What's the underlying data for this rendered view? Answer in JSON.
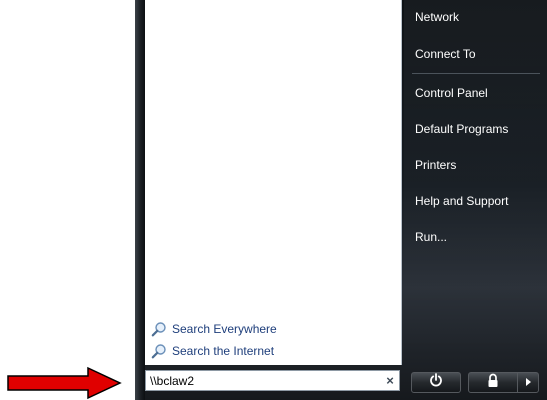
{
  "right_menu": {
    "items": [
      {
        "label": "Network"
      },
      {
        "label": "Connect To"
      },
      {
        "label": "Control Panel"
      },
      {
        "label": "Default Programs"
      },
      {
        "label": "Printers"
      },
      {
        "label": "Help and Support"
      },
      {
        "label": "Run..."
      }
    ]
  },
  "left_pane": {
    "search_everywhere_label": "Search Everywhere",
    "search_internet_label": "Search the Internet"
  },
  "search": {
    "value": "\\\\bclaw2",
    "clear_glyph": "×"
  },
  "icons": {
    "search_link_icon": "magnifier-icon",
    "power_icon": "power-icon",
    "lock_icon": "padlock-icon",
    "more_icon": "arrow-right-icon"
  },
  "colors": {
    "annotation_arrow": "#e00000",
    "link_text": "#1e3e7b",
    "menu_text": "#ffffff"
  }
}
